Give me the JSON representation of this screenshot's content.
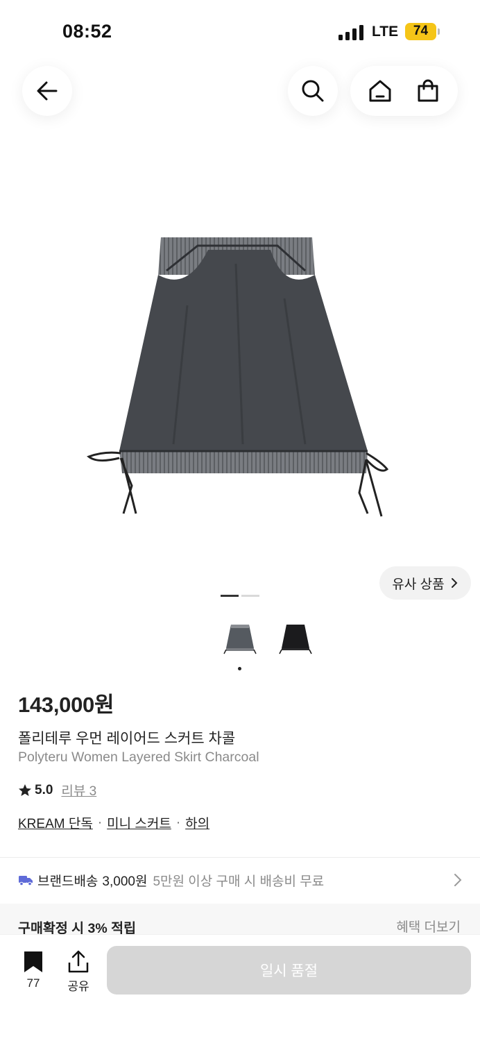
{
  "status_bar": {
    "time": "08:52",
    "network": "LTE",
    "battery": "74",
    "battery_color": "#f5c518"
  },
  "nav": {
    "back_icon": "arrow-left-icon",
    "search_icon": "search-icon",
    "home_icon": "home-icon",
    "cart_icon": "shopping-bag-icon"
  },
  "gallery": {
    "similar_label": "유사 상품",
    "page_current": 1,
    "page_total": 2,
    "thumbnails": [
      "gray-skirt",
      "black-skirt"
    ]
  },
  "product": {
    "price": "143,000원",
    "title_ko": "폴리테루 우먼 레이어드 스커트 차콜",
    "title_en": "Polyteru Women Layered Skirt Charcoal",
    "rating": "5.0",
    "review_label": "리뷰 3",
    "tags": [
      "KREAM 단독",
      "미니 스커트",
      "하의"
    ],
    "tag_separator": "·"
  },
  "shipping": {
    "icon": "truck-icon",
    "label": "브랜드배송",
    "fee": "3,000원",
    "description": "5만원 이상 구매 시 배송비 무료",
    "accent_color": "#5f6bd8"
  },
  "benefit": {
    "text": "구매확정 시 3% 적립",
    "more": "혜택 더보기"
  },
  "bottom_bar": {
    "bookmark_count": "77",
    "share_label": "공유",
    "soldout_label": "일시 품절"
  }
}
